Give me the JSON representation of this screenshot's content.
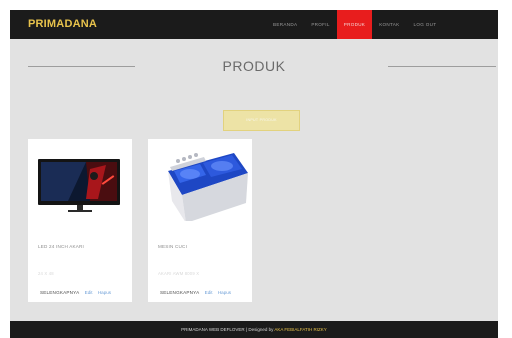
{
  "brand": "PRIMADANA",
  "nav": [
    "BERANDA",
    "PROFIL",
    "PRODUK",
    "KONTAK",
    "LOG OUT"
  ],
  "page_title": "PRODUK",
  "input_button": "INPUT PRODUK",
  "products": [
    {
      "name": "LED 24 INCH AKARI",
      "price": "24 X 48",
      "more": "SELENGKAPNYA",
      "edit": "Edit",
      "delete": "Hapus"
    },
    {
      "name": "MESIN CUCI",
      "price": "AKARI AWM 8009 X",
      "more": "SELENGKAPNYA",
      "edit": "Edit",
      "delete": "Hapus"
    }
  ],
  "footer": {
    "text": "PRIMADANA WEB DEFLOVER | Designed by ",
    "author": "AKA FEBIALFATIH RIZKY"
  },
  "colors": {
    "navbar": "#1b1b1b",
    "brand": "#e8c34c",
    "active_nav": "#e81d1d",
    "background": "#e2e2e2",
    "input_button": "#ede3a6",
    "link": "#6fa0d8"
  }
}
